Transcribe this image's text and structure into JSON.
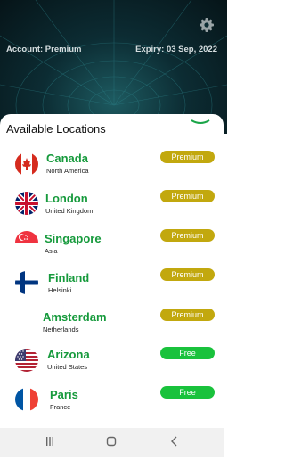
{
  "header": {
    "account": "Account: Premium",
    "expiry": "Expiry: 03 Sep, 2022",
    "settings_icon": "gear-icon"
  },
  "sheet": {
    "title": "Available Locations"
  },
  "locations": [
    {
      "city": "Canada",
      "region": "North America",
      "plan": "Premium",
      "flag": "canada-flag-icon"
    },
    {
      "city": "London",
      "region": "United Kingdom",
      "plan": "Premium",
      "flag": "uk-flag-icon"
    },
    {
      "city": "Singapore",
      "region": "Asia",
      "plan": "Premium",
      "flag": "singapore-flag-icon"
    },
    {
      "city": "Finland",
      "region": "Helsinki",
      "plan": "Premium",
      "flag": "finland-flag-icon"
    },
    {
      "city": "Amsterdam",
      "region": "Netherlands",
      "plan": "Premium",
      "flag": ""
    },
    {
      "city": "Arizona",
      "region": "United States",
      "plan": "Free",
      "flag": "usa-flag-icon"
    },
    {
      "city": "Paris",
      "region": "France",
      "plan": "Free",
      "flag": "france-flag-icon"
    }
  ],
  "colors": {
    "premium_badge": "#c2a80e",
    "free_badge": "#19c23c",
    "city_text": "#169a3c"
  },
  "navbar": {
    "recents_icon": "recents-icon",
    "home_icon": "home-icon",
    "back_icon": "back-icon"
  }
}
